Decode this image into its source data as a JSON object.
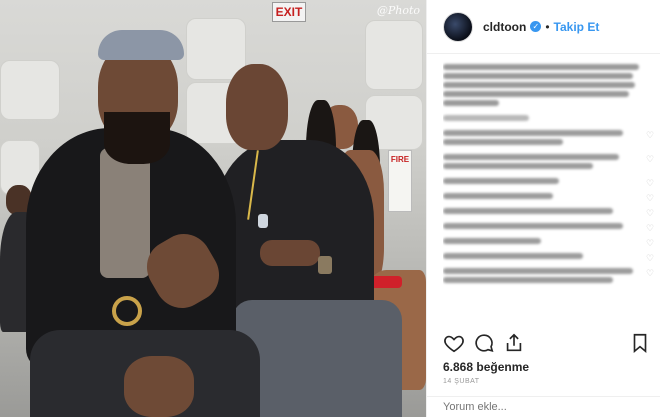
{
  "photo": {
    "exit_sign": "EXIT",
    "watermark": "@Photo",
    "fire_sign": "FIRE"
  },
  "header": {
    "username": "cldtoon",
    "separator": "•",
    "follow_label": "Takip Et"
  },
  "post": {
    "likes_text": "6.868 beğenme",
    "date_text": "14 ŞUBAT"
  },
  "comment_box": {
    "placeholder": "Yorum ekle..."
  },
  "icons": {
    "verified": "verified-badge-icon",
    "like": "heart-icon",
    "comment": "comment-icon",
    "share": "share-icon",
    "save": "bookmark-icon"
  },
  "colors": {
    "accent": "#3897f0",
    "text": "#262626",
    "muted": "#999999"
  }
}
